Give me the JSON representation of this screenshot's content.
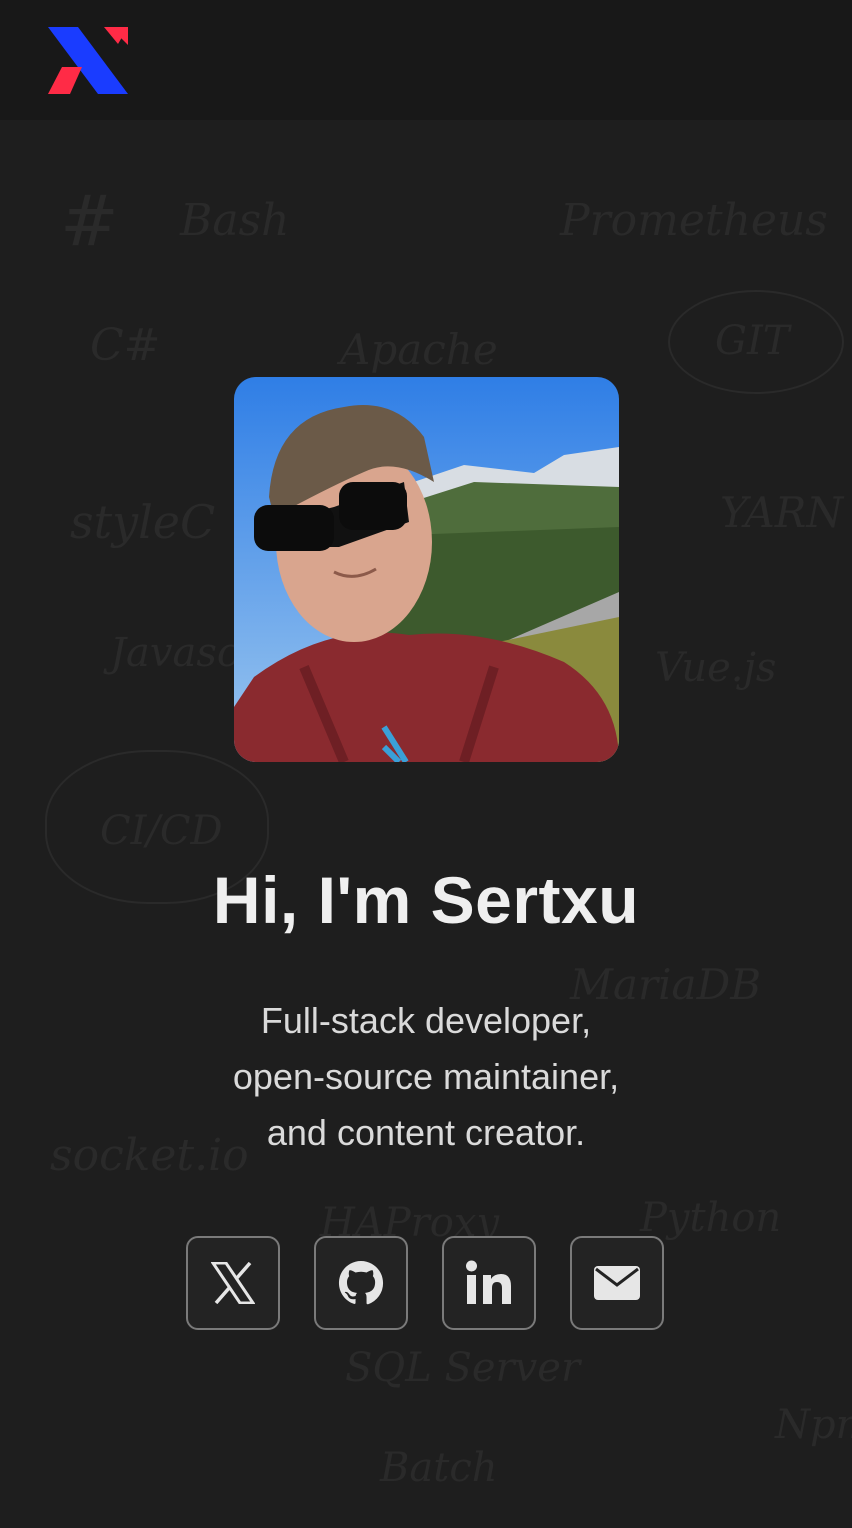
{
  "header": {
    "logo_icon": "x-shaped-brand-logo",
    "brand_colors": {
      "blue": "#1a3cff",
      "red": "#ff2b46"
    }
  },
  "background": {
    "doodles": [
      "Bash",
      "Prometheus",
      "C#",
      "Apache",
      "GIT",
      "styleC",
      "YARN",
      "Javasc",
      "Vue.js",
      "CI/CD",
      "MariaDB",
      "socket.io",
      "HAProxy",
      "Python",
      "SQL Server",
      "Batch",
      "Npm"
    ]
  },
  "profile": {
    "avatar_icon": "profile-photo",
    "greeting": "Hi, I'm Sertxu",
    "tagline": [
      "Full-stack developer,",
      "open-source maintainer,",
      "and content creator."
    ]
  },
  "socials": [
    {
      "icon": "x-twitter-icon"
    },
    {
      "icon": "github-icon"
    },
    {
      "icon": "linkedin-icon"
    },
    {
      "icon": "mail-icon"
    }
  ],
  "colors": {
    "background": "#1e1e1e",
    "topbar": "#181818",
    "button_border": "#7a7a7a"
  }
}
